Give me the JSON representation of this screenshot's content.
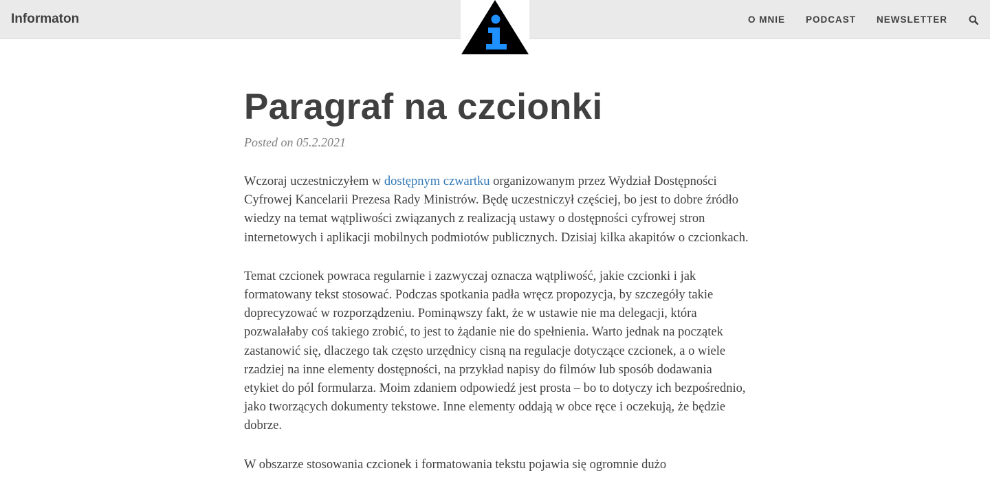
{
  "site": {
    "brand": "Informaton",
    "logo_icon": "info-triangle-icon",
    "colors": {
      "navbar_bg": "#eaeaea",
      "logo_accent": "#1e90ff",
      "link": "#337ab7"
    }
  },
  "nav": {
    "items": [
      {
        "label": "O MNIE"
      },
      {
        "label": "PODCAST"
      },
      {
        "label": "NEWSLETTER"
      }
    ],
    "search_icon": "search-icon"
  },
  "post": {
    "title": "Paragraf na czcionki",
    "meta": "Posted on 05.2.2021",
    "p1_before": "Wczoraj uczestniczyłem w ",
    "p1_link": "dostępnym czwartku",
    "p1_after": " organizowanym przez Wydział Dostępności Cyfrowej Kancelarii Prezesa Rady Ministrów. Będę uczestniczył częściej, bo jest to dobre źródło wiedzy na temat wątpliwości związanych z realizacją ustawy o dostępności cyfrowej stron internetowych i aplikacji mobilnych podmiotów publicznych. Dzisiaj kilka akapitów o czcionkach.",
    "p2": "Temat czcionek powraca regularnie i zazwyczaj oznacza wątpliwość, jakie czcionki i jak formatowany tekst stosować. Podczas spotkania padła wręcz propozycja, by szczegóły takie doprecyzować w rozporządzeniu. Pominąwszy fakt, że w ustawie nie ma delegacji, która pozwalałaby coś takiego zrobić, to jest to żądanie nie do spełnienia. Warto jednak na początek zastanowić się, dlaczego tak często urzędnicy cisną na regulacje dotyczące czcionek, a o wiele rzadziej na inne elementy dostępności, na przykład napisy do filmów lub sposób dodawania etykiet do pól formularza. Moim zdaniem odpowiedź jest prosta – bo to dotyczy ich bezpośrednio, jako tworzących dokumenty tekstowe. Inne elementy oddają w obce ręce i oczekują, że będzie dobrze.",
    "p3": "W obszarze stosowania czcionek i formatowania tekstu pojawia się ogromnie dużo"
  }
}
